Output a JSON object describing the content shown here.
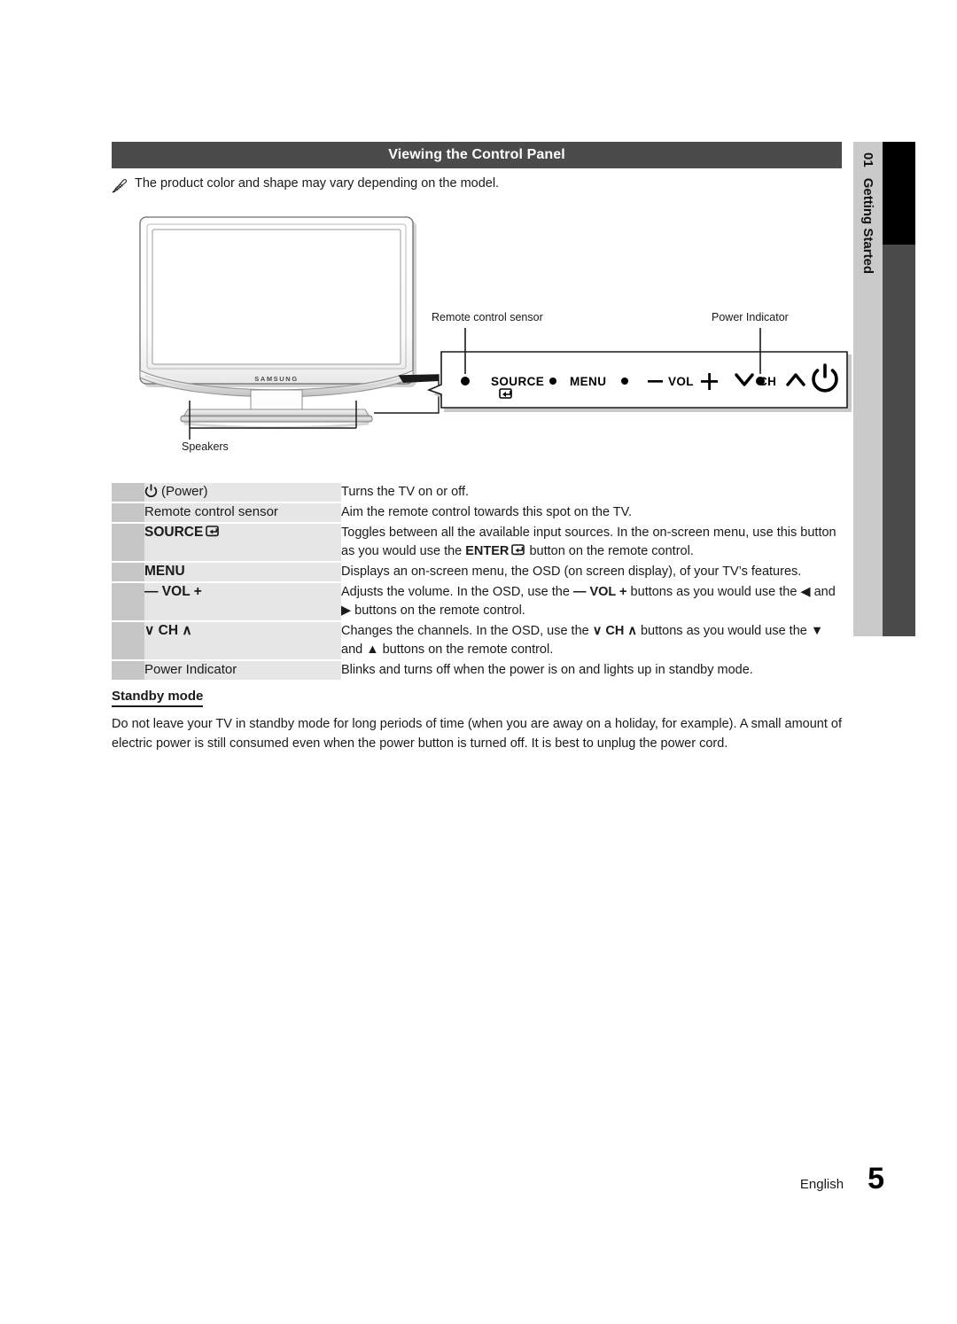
{
  "section": {
    "header_title": "Viewing the Control Panel",
    "note_icon": "pencil-note-icon",
    "note_text": "The product color and shape may vary depending on the model."
  },
  "chapter_tab": {
    "number": "01",
    "label": "Getting Started"
  },
  "diagram": {
    "tv_brand": "SAMSUNG",
    "callouts": {
      "remote_sensor": "Remote control sensor",
      "power_indicator": "Power Indicator",
      "speakers": "Speakers"
    },
    "control_panel_buttons": [
      "SOURCE",
      "MENU",
      "VOL",
      "CH",
      "power-icon"
    ],
    "control_panel_marks": {
      "minus": "—",
      "plus": "+",
      "ch_down": "chevron-down-icon",
      "ch_up": "chevron-up-icon",
      "source_enter": "enter-icon",
      "power": "power-icon"
    }
  },
  "table": {
    "rows": [
      {
        "label_prefix": "power-icon",
        "label": "(Power)",
        "bold": false,
        "desc_segments": [
          {
            "t": "Turns the TV on or off.",
            "style": "plain"
          }
        ]
      },
      {
        "label_prefix": "",
        "label": "Remote control sensor",
        "bold": false,
        "desc_segments": [
          {
            "t": "Aim the remote control towards this spot on the TV.",
            "style": "plain"
          }
        ]
      },
      {
        "label_prefix": "",
        "label": "SOURCE",
        "label_suffix_icon": "enter-icon",
        "bold": true,
        "desc_segments": [
          {
            "t": "Toggles between all the available input sources. In the on-screen menu, use this button as you would use the ",
            "style": "plain"
          },
          {
            "t": "ENTER",
            "style": "bold"
          },
          {
            "t": "enter-icon",
            "style": "icon"
          },
          {
            "t": " button on the remote control.",
            "style": "plain"
          }
        ]
      },
      {
        "label_prefix": "",
        "label": "MENU",
        "bold": true,
        "desc_segments": [
          {
            "t": "Displays an on-screen menu, the OSD (on screen display), of your TV’s features.",
            "style": "plain"
          }
        ]
      },
      {
        "label_prefix": "",
        "label": "— VOL +",
        "bold": true,
        "desc_segments": [
          {
            "t": "Adjusts the volume. In the OSD, use the ",
            "style": "plain"
          },
          {
            "t": "— VOL +",
            "style": "bold"
          },
          {
            "t": " buttons as you would use the ◀ and ▶ buttons on the remote control.",
            "style": "plain"
          }
        ]
      },
      {
        "label_prefix": "",
        "label": "∨ CH ∧",
        "bold": true,
        "desc_segments": [
          {
            "t": "Changes the channels. In the OSD, use the ",
            "style": "plain"
          },
          {
            "t": "∨ CH ∧",
            "style": "bold"
          },
          {
            "t": " buttons as you would use the ▼ and ▲ buttons on the remote control.",
            "style": "plain"
          }
        ]
      },
      {
        "label_prefix": "",
        "label": "Power Indicator",
        "bold": false,
        "desc_segments": [
          {
            "t": "Blinks and turns off when the power is on and lights up in standby mode.",
            "style": "plain"
          }
        ]
      }
    ]
  },
  "standby": {
    "title": "Standby mode",
    "body": "Do not leave your TV in standby mode for long periods of time (when you are away on a holiday, for example). A small amount of electric power is still consumed even when the power button is turned off. It is best to unplug the power cord."
  },
  "footer": {
    "language": "English",
    "page_number": "5"
  },
  "colors": {
    "header_bar": "#4b4b4b",
    "tab_light": "#cacaca",
    "tab_black": "#000000",
    "tab_dark": "#4b4b4b",
    "cell_swatch": "#c6c6c6",
    "cell_label": "#e6e6e6"
  }
}
